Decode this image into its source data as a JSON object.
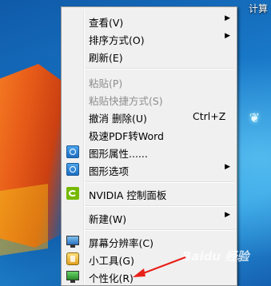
{
  "desktop": {
    "top_right_label": "计算"
  },
  "menu": {
    "items": [
      {
        "label": "查看(V)",
        "submenu": true
      },
      {
        "label": "排序方式(O)",
        "submenu": true
      },
      {
        "label": "刷新(E)"
      },
      {
        "label": "粘贴(P)",
        "disabled": true
      },
      {
        "label": "粘贴快捷方式(S)",
        "disabled": true
      },
      {
        "label": "撤消 删除(U)",
        "shortcut": "Ctrl+Z"
      },
      {
        "label": "极速PDF转Word"
      },
      {
        "label": "图形属性......",
        "icon": "graphics-properties-icon"
      },
      {
        "label": "图形选项",
        "icon": "graphics-options-icon",
        "submenu": true
      },
      {
        "label": "NVIDIA 控制面板",
        "icon": "nvidia-icon"
      },
      {
        "label": "新建(W)",
        "submenu": true
      },
      {
        "label": "屏幕分辨率(C)",
        "icon": "monitor-icon"
      },
      {
        "label": "小工具(G)",
        "icon": "gadget-icon"
      },
      {
        "label": "个性化(R)",
        "icon": "personalize-icon"
      }
    ],
    "submenu_glyph": "▶"
  },
  "watermark": {
    "text": "Baidu 经验"
  },
  "colors": {
    "menu_background": "#f0f0f0",
    "disabled_text": "#8d8d8d",
    "annotation_arrow": "#e8201a"
  }
}
